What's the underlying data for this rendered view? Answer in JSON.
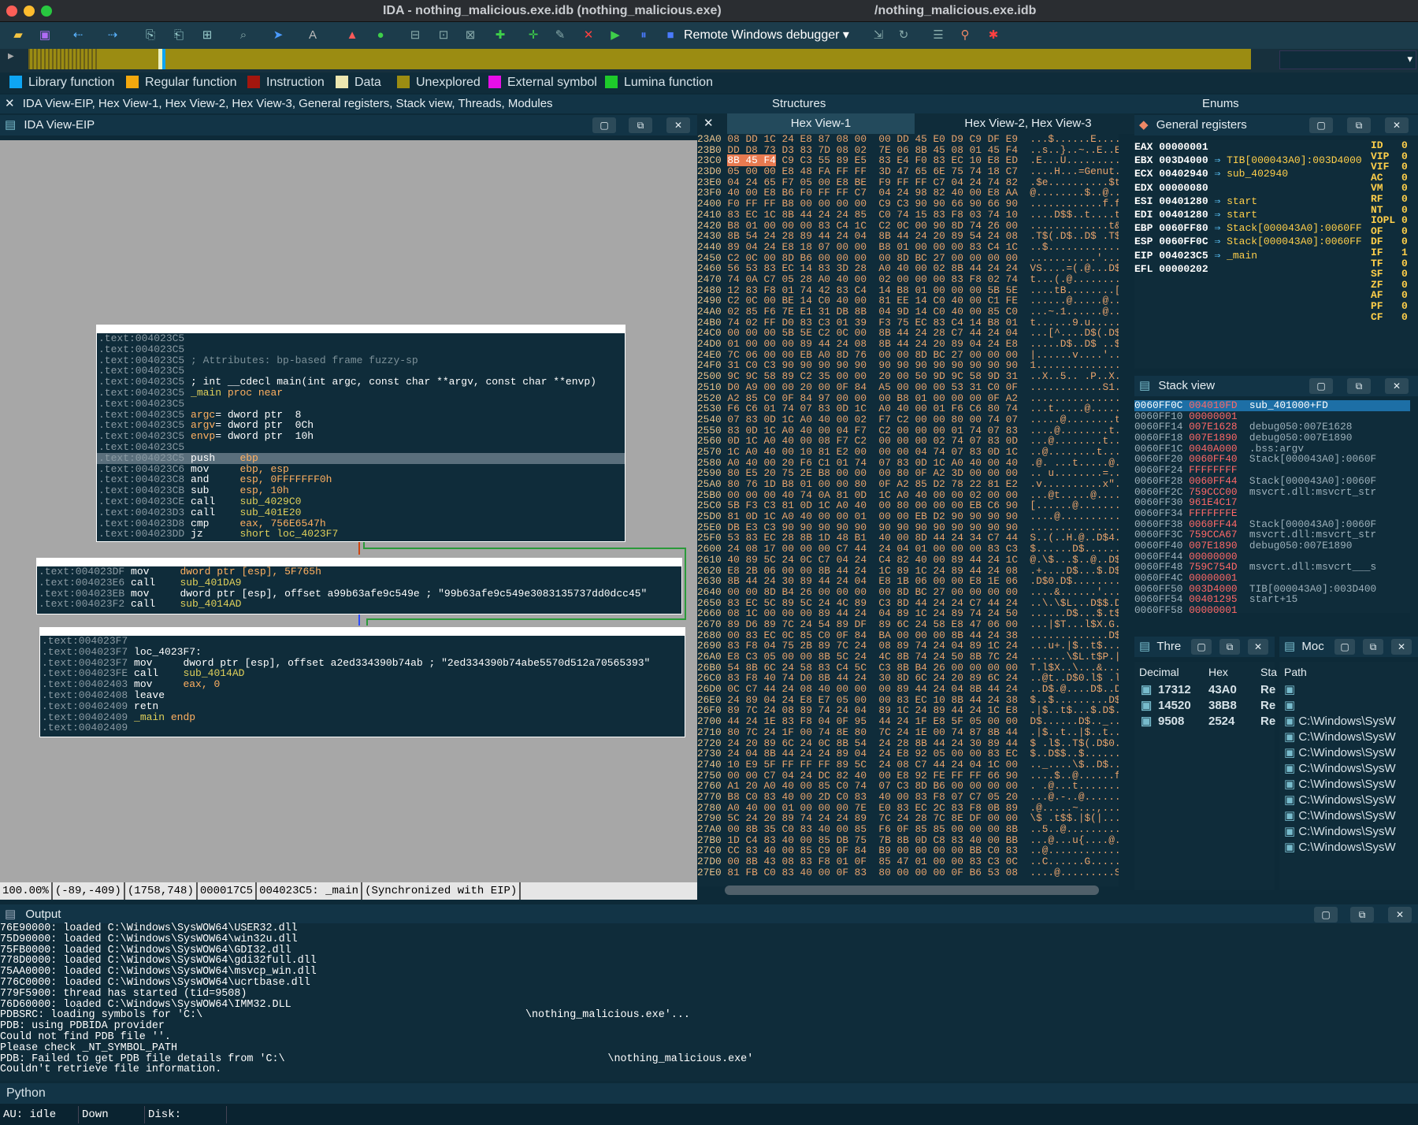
{
  "window": {
    "title": "IDA - nothing_malicious.exe.idb (nothing_malicious.exe)",
    "path_title": "/nothing_malicious.exe.idb"
  },
  "toolbar": {
    "debugger_select": "Remote Windows debugger",
    "icons": [
      "open-icon",
      "save-icon",
      "back-icon",
      "forward-icon",
      "debug-icon",
      "play-icon",
      "pause-icon",
      "stop-icon"
    ]
  },
  "legend": [
    {
      "label": "Library function",
      "color": "#0ea5f3"
    },
    {
      "label": "Regular function",
      "color": "#f3a80e"
    },
    {
      "label": "Instruction",
      "color": "#a3160e"
    },
    {
      "label": "Data",
      "color": "#ece6b0"
    },
    {
      "label": "Unexplored",
      "color": "#9b8c12"
    },
    {
      "label": "External symbol",
      "color": "#e80ee8"
    },
    {
      "label": "Lumina function",
      "color": "#1ecb2b"
    }
  ],
  "tabs": {
    "main": "IDA View-EIP, Hex View-1, Hex View-2, Hex View-3, General registers, Stack view, Threads, Modules",
    "structures": "Structures",
    "enums": "Enums",
    "ida_view": "IDA View-EIP",
    "hex1": "Hex View-1",
    "hex23": "Hex View-2, Hex View-3",
    "regs": "General registers",
    "stack": "Stack view",
    "threads": "Thre",
    "modules": "Moc",
    "output": "Output",
    "python": "Python"
  },
  "graph": {
    "block1": [
      [
        ".text:004023C5",
        "",
        ""
      ],
      [
        ".text:004023C5",
        "",
        ""
      ],
      [
        ".text:004023C5",
        "; Attributes: bp-based frame fuzzy-sp",
        ""
      ],
      [
        ".text:004023C5",
        "",
        ""
      ],
      [
        ".text:004023C5",
        "; int __cdecl main(int argc, const char **argv, const char **envp)",
        ""
      ],
      [
        ".text:004023C5",
        "_main",
        "proc near"
      ],
      [
        ".text:004023C5",
        "",
        ""
      ],
      [
        ".text:004023C5",
        "argc",
        "= dword ptr  8"
      ],
      [
        ".text:004023C5",
        "argv",
        "= dword ptr  0Ch"
      ],
      [
        ".text:004023C5",
        "envp",
        "= dword ptr  10h"
      ],
      [
        ".text:004023C5",
        "",
        ""
      ],
      [
        ".text:004023C5",
        "push",
        "ebp"
      ],
      [
        ".text:004023C6",
        "mov",
        "ebp, esp"
      ],
      [
        ".text:004023C8",
        "and",
        "esp, 0FFFFFFF0h"
      ],
      [
        ".text:004023CB",
        "sub",
        "esp, 10h"
      ],
      [
        ".text:004023CE",
        "call",
        "sub_4029C0"
      ],
      [
        ".text:004023D3",
        "call",
        "sub_401E20"
      ],
      [
        ".text:004023D8",
        "cmp",
        "eax, 756E6547h"
      ],
      [
        ".text:004023DD",
        "jz",
        "short loc_4023F7"
      ]
    ],
    "block2": [
      [
        ".text:004023DF",
        "mov",
        "dword ptr [esp], 5F765h"
      ],
      [
        ".text:004023E6",
        "call",
        "sub_401DA9"
      ],
      [
        ".text:004023EB",
        "mov",
        "dword ptr [esp], offset a99b63afe9c549e ; \"99b63afe9c549e3083135737dd0dcc45\""
      ],
      [
        ".text:004023F2",
        "call",
        "sub_4014AD"
      ]
    ],
    "block3": [
      [
        ".text:004023F7",
        "",
        ""
      ],
      [
        ".text:004023F7",
        "loc_4023F7:",
        ""
      ],
      [
        ".text:004023F7",
        "mov",
        "dword ptr [esp], offset a2ed334390b74ab ; \"2ed334390b74abe5570d512a70565393\""
      ],
      [
        ".text:004023FE",
        "call",
        "sub_4014AD"
      ],
      [
        ".text:00402403",
        "mov",
        "eax, 0"
      ],
      [
        ".text:00402408",
        "leave",
        ""
      ],
      [
        ".text:00402409",
        "retn",
        ""
      ],
      [
        ".text:00402409",
        "_main",
        "endp"
      ],
      [
        ".text:00402409",
        "",
        ""
      ]
    ],
    "status": [
      "100.00%",
      "(-89,-409)",
      "(1758,748)",
      "000017C5",
      "004023C5: _main",
      "(Synchronized with EIP)"
    ]
  },
  "hex": [
    [
      "23A0",
      "08 DD 1C 24 E8 87 08 00  00 DD 45 E0 D9 C9 DF E9",
      "...$......E....."
    ],
    [
      "23B0",
      "DD D8 73 D3 83 7D 08 02  7E 06 8B 45 08 01 45 F4",
      "..s..}..~..E..E."
    ],
    [
      "23C0",
      "8B 45 F4 C9 C3 55 89 E5  83 E4 F0 83 EC 10 E8 ED",
      ".E...U.........."
    ],
    [
      "23D0",
      "05 00 00 E8 48 FA FF FF  3D 47 65 6E 75 74 18 C7",
      "....H...=Genut.."
    ],
    [
      "23E0",
      "04 24 65 F7 05 00 E8 BE  F9 FF FF C7 04 24 74 82",
      ".$e..........$t."
    ],
    [
      "23F0",
      "40 00 E8 B6 F0 FF FF C7  04 24 98 82 40 00 E8 AA",
      "@........$..@..."
    ],
    [
      "2400",
      "F0 FF FF B8 00 00 00 00  C9 C3 90 90 66 90 66 90",
      "............f.f."
    ],
    [
      "2410",
      "83 EC 1C 8B 44 24 24 85  C0 74 15 83 F8 03 74 10",
      "....D$$..t....t."
    ],
    [
      "2420",
      "B8 01 00 00 00 83 C4 1C  C2 0C 00 90 8D 74 26 00",
      ".............t&."
    ],
    [
      "2430",
      "8B 54 24 28 89 44 24 04  8B 44 24 20 89 54 24 08",
      ".T$(.D$..D$ .T$."
    ],
    [
      "2440",
      "89 04 24 E8 18 07 00 00  B8 01 00 00 00 83 C4 1C",
      "..$............."
    ],
    [
      "2450",
      "C2 0C 00 8D B6 00 00 00  00 8D BC 27 00 00 00 00",
      "...........'...."
    ],
    [
      "2460",
      "56 53 83 EC 14 83 3D 28  A0 40 00 02 8B 44 24 24",
      "VS....=(.@...D$$"
    ],
    [
      "2470",
      "74 0A C7 05 28 A0 40 00  02 00 00 00 83 F8 02 74",
      "t...(.@........t"
    ],
    [
      "2480",
      "12 83 F8 01 74 42 83 C4  14 B8 01 00 00 00 5B 5E",
      "....tB........[^"
    ],
    [
      "2490",
      "C2 0C 00 BE 14 C0 40 00  81 EE 14 C0 40 00 C1 FE",
      "......@.....@..."
    ],
    [
      "24A0",
      "02 85 F6 7E E1 31 DB 8B  04 9D 14 C0 40 00 85 C0",
      "...~.1......@..."
    ],
    [
      "24B0",
      "74 02 FF D0 83 C3 01 39  F3 75 EC 83 C4 14 B8 01",
      "t......9.u......"
    ],
    [
      "24C0",
      "00 00 00 5B 5E C2 0C 00  8B 44 24 28 C7 44 24 04",
      "...[^....D$(.D$."
    ],
    [
      "24D0",
      "01 00 00 00 89 44 24 08  8B 44 24 20 89 04 24 E8",
      ".....D$..D$ ..$."
    ],
    [
      "24E0",
      "7C 06 00 00 EB A0 8D 76  00 00 8D BC 27 00 00 00",
      "|......v....'..."
    ],
    [
      "24F0",
      "31 C0 C3 90 90 90 90 90  90 90 90 90 90 90 90 90",
      "1..............."
    ],
    [
      "2500",
      "9C 9C 58 89 C2 35 00 00  20 00 50 9D 9C 58 9D 31",
      "..X..5.. .P..X.1"
    ],
    [
      "2510",
      "D0 A9 00 00 20 00 0F 84  A5 00 00 00 53 31 C0 0F",
      "............S1.."
    ],
    [
      "2520",
      "A2 85 C0 0F 84 97 00 00  00 B8 01 00 00 00 0F A2",
      "................"
    ],
    [
      "2530",
      "F6 C6 01 74 07 83 0D 1C  A0 40 00 01 F6 C6 80 74",
      "...t.....@.....t"
    ],
    [
      "2540",
      "07 83 0D 1C A0 40 00 02  F7 C2 00 00 80 00 74 07",
      ".....@........t."
    ],
    [
      "2550",
      "83 0D 1C A0 40 00 04 F7  C2 00 00 00 01 74 07 83",
      "....@........t.."
    ],
    [
      "2560",
      "0D 1C A0 40 00 08 F7 C2  00 00 00 02 74 07 83 0D",
      "...@........t..."
    ],
    [
      "2570",
      "1C A0 40 00 10 81 E2 00  00 00 04 74 07 83 0D 1C",
      "..@........t...."
    ],
    [
      "2580",
      "A0 40 00 20 F6 C1 01 74  07 83 0D 1C A0 40 00 40",
      ".@. ...t.....@.@"
    ],
    [
      "2590",
      "80 E5 20 75 2E B8 00 00  00 80 0F A2 3D 00 00 00",
      ".. u........=..."
    ],
    [
      "25A0",
      "80 76 1D B8 01 00 00 80  0F A2 85 D2 78 22 81 E2",
      ".v..........x\"..."
    ],
    [
      "25B0",
      "00 00 00 40 74 0A 81 0D  1C A0 40 00 00 02 00 00",
      "...@t.....@....."
    ],
    [
      "25C0",
      "5B F3 C3 81 0D 1C A0 40  00 80 00 00 00 EB C6 90",
      "[......@........"
    ],
    [
      "25D0",
      "81 0D 1C A0 40 00 00 01  00 00 EB D2 90 90 90 90",
      "....@..........."
    ],
    [
      "25E0",
      "DB E3 C3 90 90 90 90 90  90 90 90 90 90 90 90 90",
      "................"
    ],
    [
      "25F0",
      "53 83 EC 28 8B 1D 48 B1  40 00 8D 44 24 34 C7 44",
      "S..(..H.@..D$4.D"
    ],
    [
      "2600",
      "24 08 17 00 00 00 C7 44  24 04 01 00 00 00 83 C3",
      "$......D$......."
    ],
    [
      "2610",
      "40 89 5C 24 0C C7 04 24  C4 82 40 00 89 44 24 1C",
      "@.\\$...$..@..D$."
    ],
    [
      "2620",
      "E8 2B 06 00 00 8B 44 24  1C 89 1C 24 89 44 24 08",
      ".+....D$...$.D$."
    ],
    [
      "2630",
      "8B 44 24 30 89 44 24 04  E8 1B 06 00 00 E8 1E 06",
      ".D$0.D$........."
    ],
    [
      "2640",
      "00 00 8D B4 26 00 00 00  00 8D BC 27 00 00 00 00",
      "....&......'...."
    ],
    [
      "2650",
      "83 EC 5C 89 5C 24 4C 89  C3 8D 44 24 24 C7 44 24",
      "..\\.\\$L...D$$.D$"
    ],
    [
      "2660",
      "08 1C 00 00 00 89 44 24  04 89 1C 24 89 74 24 50",
      "......D$...$.t$P"
    ],
    [
      "2670",
      "89 D6 89 7C 24 54 89 DF  89 6C 24 58 E8 47 06 00",
      "...|$T...l$X.G.."
    ],
    [
      "2680",
      "00 83 EC 0C 85 C0 0F 84  BA 00 00 00 8B 44 24 38",
      ".............D$8"
    ],
    [
      "2690",
      "83 F8 04 75 2B 89 7C 24  08 89 74 24 04 89 1C 24",
      "...u+.|$..t$...$"
    ],
    [
      "26A0",
      "E8 C3 05 00 00 8B 5C 24  4C 8B 74 24 50 8B 7C 24",
      "......\\$L.t$P.|$"
    ],
    [
      "26B0",
      "54 8B 6C 24 58 83 C4 5C  C3 8B B4 26 00 00 00 00",
      "T.l$X..\\...&...."
    ],
    [
      "26C0",
      "83 F8 40 74 D0 8B 44 24  30 8D 6C 24 20 89 6C 24",
      "..@t..D$0.l$ .l$"
    ],
    [
      "26D0",
      "0C C7 44 24 08 40 00 00  00 89 44 24 04 8B 44 24",
      "..D$.@....D$..D$"
    ],
    [
      "26E0",
      "24 89 04 24 E8 E7 05 00  00 83 EC 10 8B 44 24 38",
      "$..$.........D$8"
    ],
    [
      "26F0",
      "89 7C 24 08 89 74 24 04  89 1C 24 89 44 24 1C E8",
      ".|$..t$...$.D$.."
    ],
    [
      "2700",
      "44 24 1E 83 F8 04 0F 95  44 24 1F E8 5F 05 00 00",
      "D$......D$.._..."
    ],
    [
      "2710",
      "80 7C 24 1F 00 74 8E 80  7C 24 1E 00 74 87 8B 44",
      ".|$..t..|$..t..D"
    ],
    [
      "2720",
      "24 20 89 6C 24 0C 8B 54  24 28 8B 44 24 30 89 44",
      "$ .l$..T$(.D$0.D"
    ],
    [
      "2730",
      "24 04 8B 44 24 24 89 04  24 E8 92 05 00 00 83 EC",
      "$..D$$..$......."
    ],
    [
      "2740",
      "10 E9 5F FF FF FF 89 5C  24 08 C7 44 24 04 1C 00",
      ".._....\\$..D$..."
    ],
    [
      "2750",
      "00 00 C7 04 24 DC 82 40  00 E8 92 FE FF FF 66 90",
      "....$..@......f."
    ],
    [
      "2760",
      "A1 20 A0 40 00 85 C0 74  07 C3 8D B6 00 00 00 00",
      ". .@...t........"
    ],
    [
      "2770",
      "B8 C0 83 40 00 2D C0 83  40 00 83 F8 07 C7 05 20",
      "...@.-..@...... "
    ],
    [
      "2780",
      "A0 40 00 01 00 00 00 7E  E0 83 EC 2C 83 F8 0B 89",
      ".@.....~...,...."
    ],
    [
      "2790",
      "5C 24 20 89 74 24 24 89  7C 24 28 7C 8E DF 00 00",
      "\\$ .t$$.|$(|...."
    ],
    [
      "27A0",
      "00 8B 35 C0 83 40 00 85  F6 0F 85 85 00 00 00 8B",
      "..5..@.........."
    ],
    [
      "27B0",
      "1D C4 83 40 00 85 DB 75  7B 8B 0D C8 83 40 00 BB",
      "...@...u{....@.."
    ],
    [
      "27C0",
      "CC 83 40 00 85 C9 0F 84  B9 00 00 00 00 BB C0 83",
      "..@............."
    ],
    [
      "27D0",
      "00 8B 43 08 83 F8 01 0F  85 47 01 00 00 83 C3 0C",
      "..C......G......"
    ],
    [
      "27E0",
      "81 FB C0 83 40 00 0F 83  80 00 00 00 0F B6 53 08",
      "....@.........S."
    ]
  ],
  "registers": [
    [
      "EAX",
      "00000001",
      "",
      ""
    ],
    [
      "EBX",
      "003D4000",
      "TIB[000043A0]:003D4000",
      ""
    ],
    [
      "ECX",
      "00402940",
      "sub_402940",
      ""
    ],
    [
      "EDX",
      "00000080",
      "",
      ""
    ],
    [
      "ESI",
      "00401280",
      "start",
      ""
    ],
    [
      "EDI",
      "00401280",
      "start",
      ""
    ],
    [
      "EBP",
      "0060FF80",
      "Stack[000043A0]:0060FF",
      ""
    ],
    [
      "ESP",
      "0060FF0C",
      "Stack[000043A0]:0060FF",
      ""
    ],
    [
      "EIP",
      "004023C5",
      "_main",
      ""
    ],
    [
      "EFL",
      "00000202",
      "",
      ""
    ]
  ],
  "flags": [
    [
      "ID",
      "0"
    ],
    [
      "VIP",
      "0"
    ],
    [
      "VIF",
      "0"
    ],
    [
      "AC",
      "0"
    ],
    [
      "VM",
      "0"
    ],
    [
      "RF",
      "0"
    ],
    [
      "NT",
      "0"
    ],
    [
      "IOPL",
      "0"
    ],
    [
      "OF",
      "0"
    ],
    [
      "DF",
      "0"
    ],
    [
      "IF",
      "1"
    ],
    [
      "TF",
      "0"
    ],
    [
      "SF",
      "0"
    ],
    [
      "ZF",
      "0"
    ],
    [
      "AF",
      "0"
    ],
    [
      "PF",
      "0"
    ],
    [
      "CF",
      "0"
    ]
  ],
  "stack": [
    [
      "0060FF0C",
      "004010FD",
      "sub_401000+FD"
    ],
    [
      "0060FF10",
      "00000001",
      ""
    ],
    [
      "0060FF14",
      "007E1628",
      "debug050:007E1628"
    ],
    [
      "0060FF18",
      "007E1890",
      "debug050:007E1890"
    ],
    [
      "0060FF1C",
      "0040A000",
      ".bss:argv"
    ],
    [
      "0060FF20",
      "0060FF40",
      "Stack[000043A0]:0060F"
    ],
    [
      "0060FF24",
      "FFFFFFFF",
      ""
    ],
    [
      "0060FF28",
      "0060FF44",
      "Stack[000043A0]:0060F"
    ],
    [
      "0060FF2C",
      "759CCC00",
      "msvcrt.dll:msvcrt_str"
    ],
    [
      "0060FF30",
      "961E4C17",
      ""
    ],
    [
      "0060FF34",
      "FFFFFFFE",
      ""
    ],
    [
      "0060FF38",
      "0060FF44",
      "Stack[000043A0]:0060F"
    ],
    [
      "0060FF3C",
      "759CCA67",
      "msvcrt.dll:msvcrt_str"
    ],
    [
      "0060FF40",
      "007E1890",
      "debug050:007E1890"
    ],
    [
      "0060FF44",
      "00000000",
      ""
    ],
    [
      "0060FF48",
      "759C754D",
      "msvcrt.dll:msvcrt___s"
    ],
    [
      "0060FF4C",
      "00000001",
      ""
    ],
    [
      "0060FF50",
      "003D4000",
      "TIB[000043A0]:003D400"
    ],
    [
      "0060FF54",
      "00401295",
      "start+15"
    ],
    [
      "0060FF58",
      "00000001",
      ""
    ]
  ],
  "threads": {
    "headers": [
      "Decimal",
      "Hex",
      "Sta"
    ],
    "rows": [
      [
        "17312",
        "43A0",
        "Re"
      ],
      [
        "14520",
        "38B8",
        "Re"
      ],
      [
        "9508",
        "2524",
        "Re"
      ]
    ]
  },
  "modules": {
    "header": "Path",
    "rows": [
      "",
      "",
      "C:\\Windows\\SysW",
      "C:\\Windows\\SysW",
      "C:\\Windows\\SysW",
      "C:\\Windows\\SysW",
      "C:\\Windows\\SysW",
      "C:\\Windows\\SysW",
      "C:\\Windows\\SysW",
      "C:\\Windows\\SysW",
      "C:\\Windows\\SysW"
    ]
  },
  "output": [
    "76E90000: loaded C:\\Windows\\SysWOW64\\USER32.dll",
    "75D90000: loaded C:\\Windows\\SysWOW64\\win32u.dll",
    "75FB0000: loaded C:\\Windows\\SysWOW64\\GDI32.dll",
    "778D0000: loaded C:\\Windows\\SysWOW64\\gdi32full.dll",
    "75AA0000: loaded C:\\Windows\\SysWOW64\\msvcp_win.dll",
    "776C0000: loaded C:\\Windows\\SysWOW64\\ucrtbase.dll",
    "779F5900: thread has started (tid=9508)",
    "76D60000: loaded C:\\Windows\\SysWOW64\\IMM32.DLL",
    "PDBSRC: loading symbols for 'C:\\                                                   \\nothing_malicious.exe'...",
    "PDB: using PDBIDA provider",
    "Could not find PDB file ''.",
    "Please check _NT_SYMBOL_PATH",
    "PDB: Failed to get PDB file details from 'C:\\                                                   \\nothing_malicious.exe'",
    "Couldn't retrieve file information."
  ],
  "statusbar": {
    "au": "AU:  idle",
    "dir": "Down",
    "disk": "Disk:"
  }
}
